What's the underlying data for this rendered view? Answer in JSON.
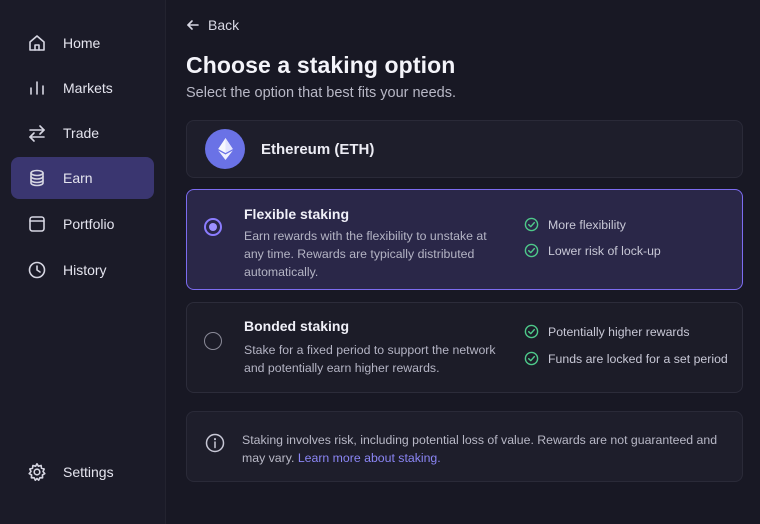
{
  "sidebar": {
    "items": [
      {
        "label": "Home",
        "icon": "home-icon",
        "active": false
      },
      {
        "label": "Markets",
        "icon": "bar-chart-icon",
        "active": false
      },
      {
        "label": "Trade",
        "icon": "swap-arrows-icon",
        "active": false
      },
      {
        "label": "Earn",
        "icon": "coin-stack-icon",
        "active": true
      },
      {
        "label": "Portfolio",
        "icon": "wallet-icon",
        "active": false
      },
      {
        "label": "History",
        "icon": "clock-icon",
        "active": false
      }
    ],
    "settings": {
      "label": "Settings",
      "icon": "gear-icon"
    }
  },
  "header": {
    "back_label": "Back",
    "title": "Choose a staking option",
    "subtitle": "Select the option that best fits your needs."
  },
  "asset": {
    "name": "Ethereum (ETH)",
    "icon": "ethereum-icon",
    "logo_color": "#6a72e6"
  },
  "options": [
    {
      "title": "Flexible staking",
      "description": "Earn rewards with the flexibility to unstake at any time. Rewards are typically distributed automatically.",
      "selected": true,
      "features": [
        "More flexibility",
        "Lower risk of lock-up"
      ]
    },
    {
      "title": "Bonded staking",
      "description": "Stake for a fixed period to support the network and potentially earn higher rewards.",
      "selected": false,
      "features": [
        "Potentially higher rewards",
        "Funds are locked for a set period"
      ]
    }
  ],
  "info": {
    "text": "Staking involves risk, including potential loss of value. Rewards are not guaranteed and may vary.",
    "link_label": "Learn more about staking."
  },
  "colors": {
    "accent": "#7c6cf0",
    "check": "#4ec98a",
    "link": "#8b86f5"
  }
}
